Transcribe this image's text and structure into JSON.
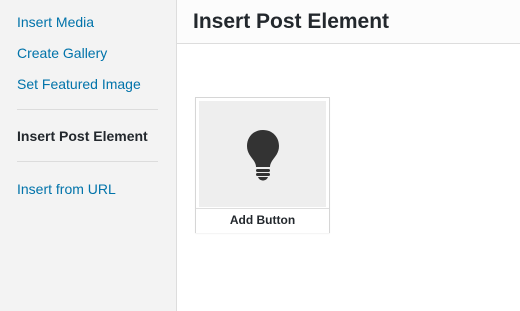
{
  "sidebar": {
    "items": [
      {
        "label": "Insert Media"
      },
      {
        "label": "Create Gallery"
      },
      {
        "label": "Set Featured Image"
      },
      {
        "label": "Insert Post Element"
      },
      {
        "label": "Insert from URL"
      }
    ]
  },
  "main": {
    "title": "Insert Post Element",
    "elements": [
      {
        "label": "Add Button",
        "icon": "lightbulb-icon"
      }
    ]
  },
  "colors": {
    "link": "#0073aa",
    "text": "#23282d",
    "sidebar_background": "#f3f3f3",
    "tile_background": "#eeeeee"
  }
}
